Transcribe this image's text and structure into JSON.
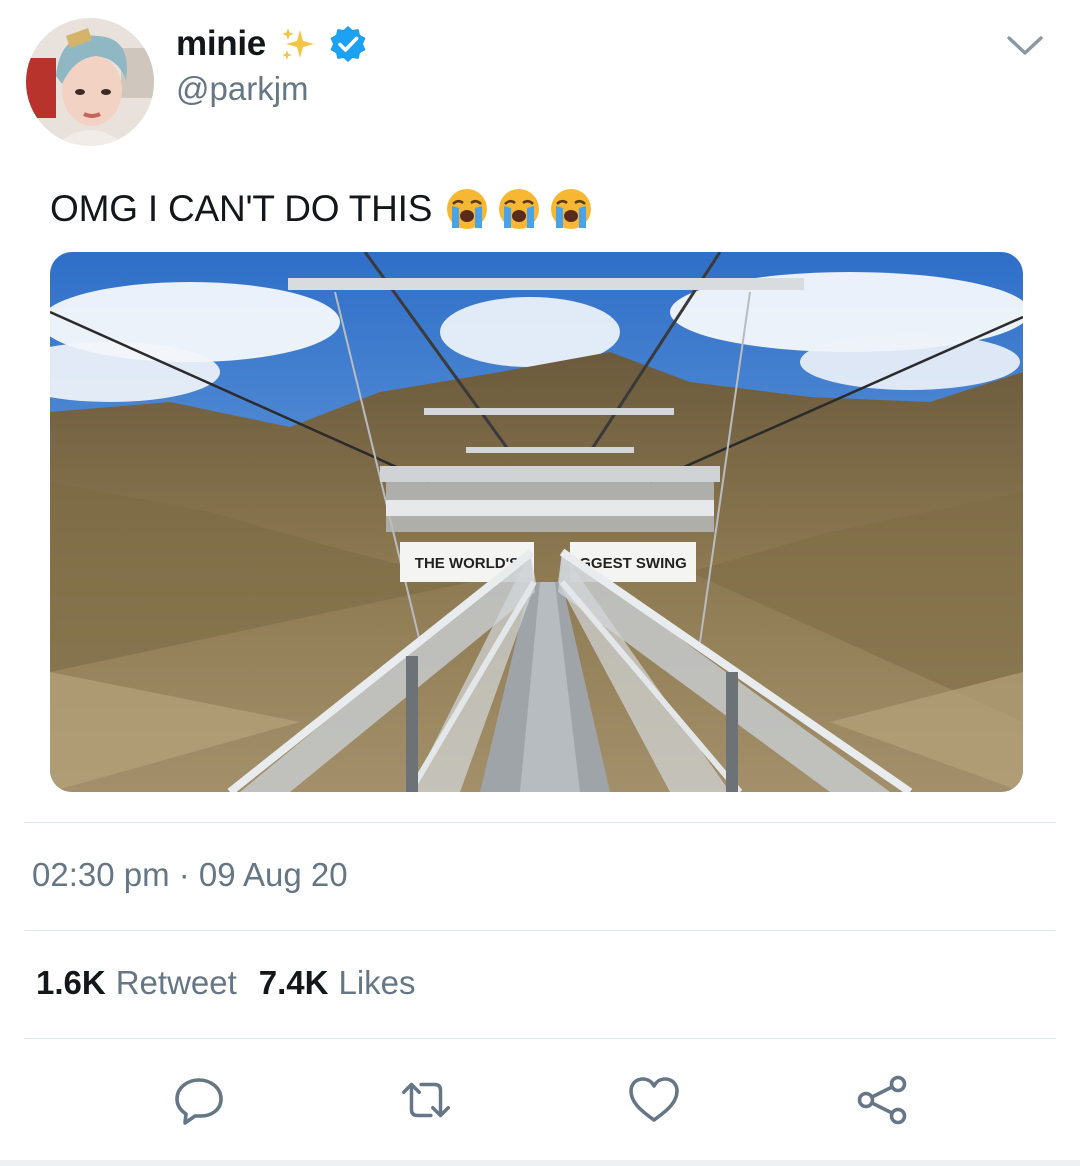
{
  "author": {
    "display_name": "minie",
    "handle": "@parkjm",
    "verified": true
  },
  "tweet": {
    "text": "OMG I CAN'T DO THIS",
    "emoji": [
      "loudly-crying-face",
      "loudly-crying-face",
      "loudly-crying-face"
    ],
    "media_sign_left": "THE WORLD'S",
    "media_sign_right": "GGEST SWING"
  },
  "timestamp": "02:30 pm · 09 Aug 20",
  "stats": {
    "retweet_count": "1.6K",
    "retweet_label": "Retweet",
    "likes_count": "7.4K",
    "likes_label": "Likes"
  },
  "actions": [
    "reply-icon",
    "retweet-icon",
    "like-icon",
    "share-icon"
  ],
  "colors": {
    "verified": "#1da1f2",
    "secondary_text": "#657786",
    "primary_text": "#14171a",
    "divider": "#e1e8ed"
  }
}
